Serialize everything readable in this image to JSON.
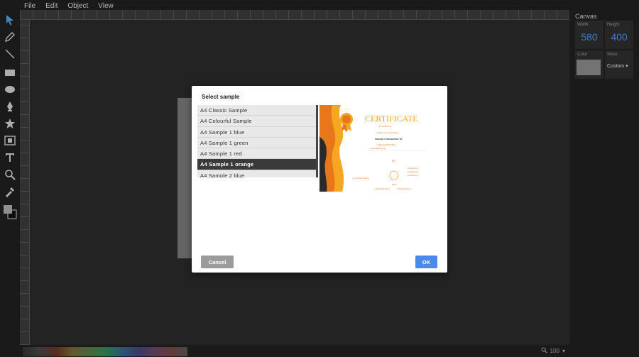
{
  "menubar": {
    "items": [
      "File",
      "Edit",
      "Object",
      "View"
    ]
  },
  "toolbar": {
    "tools": [
      "select-tool-icon",
      "pencil-icon",
      "line-icon",
      "rectangle-icon",
      "ellipse-icon",
      "pen-icon",
      "star-icon",
      "image-icon",
      "text-icon",
      "zoom-icon",
      "eyedropper-icon",
      "color-swatches-icon"
    ]
  },
  "panel": {
    "title": "Canvas",
    "width_label": "Width",
    "width_value": "580",
    "height_label": "Height",
    "height_value": "400",
    "color_label": "Color",
    "sizes_label": "Sizes",
    "sizes_value": "Custom"
  },
  "zoom": {
    "value": "100"
  },
  "dialog": {
    "title": "Select sample",
    "samples": [
      "A4 Classic Sample",
      "A4 Colourful Sample",
      "A4 Sample 1 blue",
      "A4 Sample 1 green",
      "A4 Sample 1 red",
      "A4 Sample 1 orange",
      "A4 Sample 2 blue"
    ],
    "selected_index": 5,
    "cancel_label": "Cancel",
    "ok_label": "OK"
  },
  "preview": {
    "heading": "CERTIFICATE",
    "line1": "Of Completion",
    "line2": "{{IndicationCourseTitle}}",
    "line3": "PROUDLY PRESENTED TO",
    "line4": "{{IndentedFullName}}",
    "line5": "{{IndentedEmail}}",
    "line6": "BY",
    "line7": "{{CompanyName}}",
    "line8": "{{Address1}}",
    "line9": "{{Address2}}",
    "line10": "{{Address3}}",
    "line11": "DATE",
    "line12": "{{IndentedDate}}",
    "line13": "{{ExpiresDate}}"
  },
  "colors": {
    "accent": "#4a8af0",
    "cert_orange": "#f5a623",
    "canvas_value": "#4a90e2"
  }
}
